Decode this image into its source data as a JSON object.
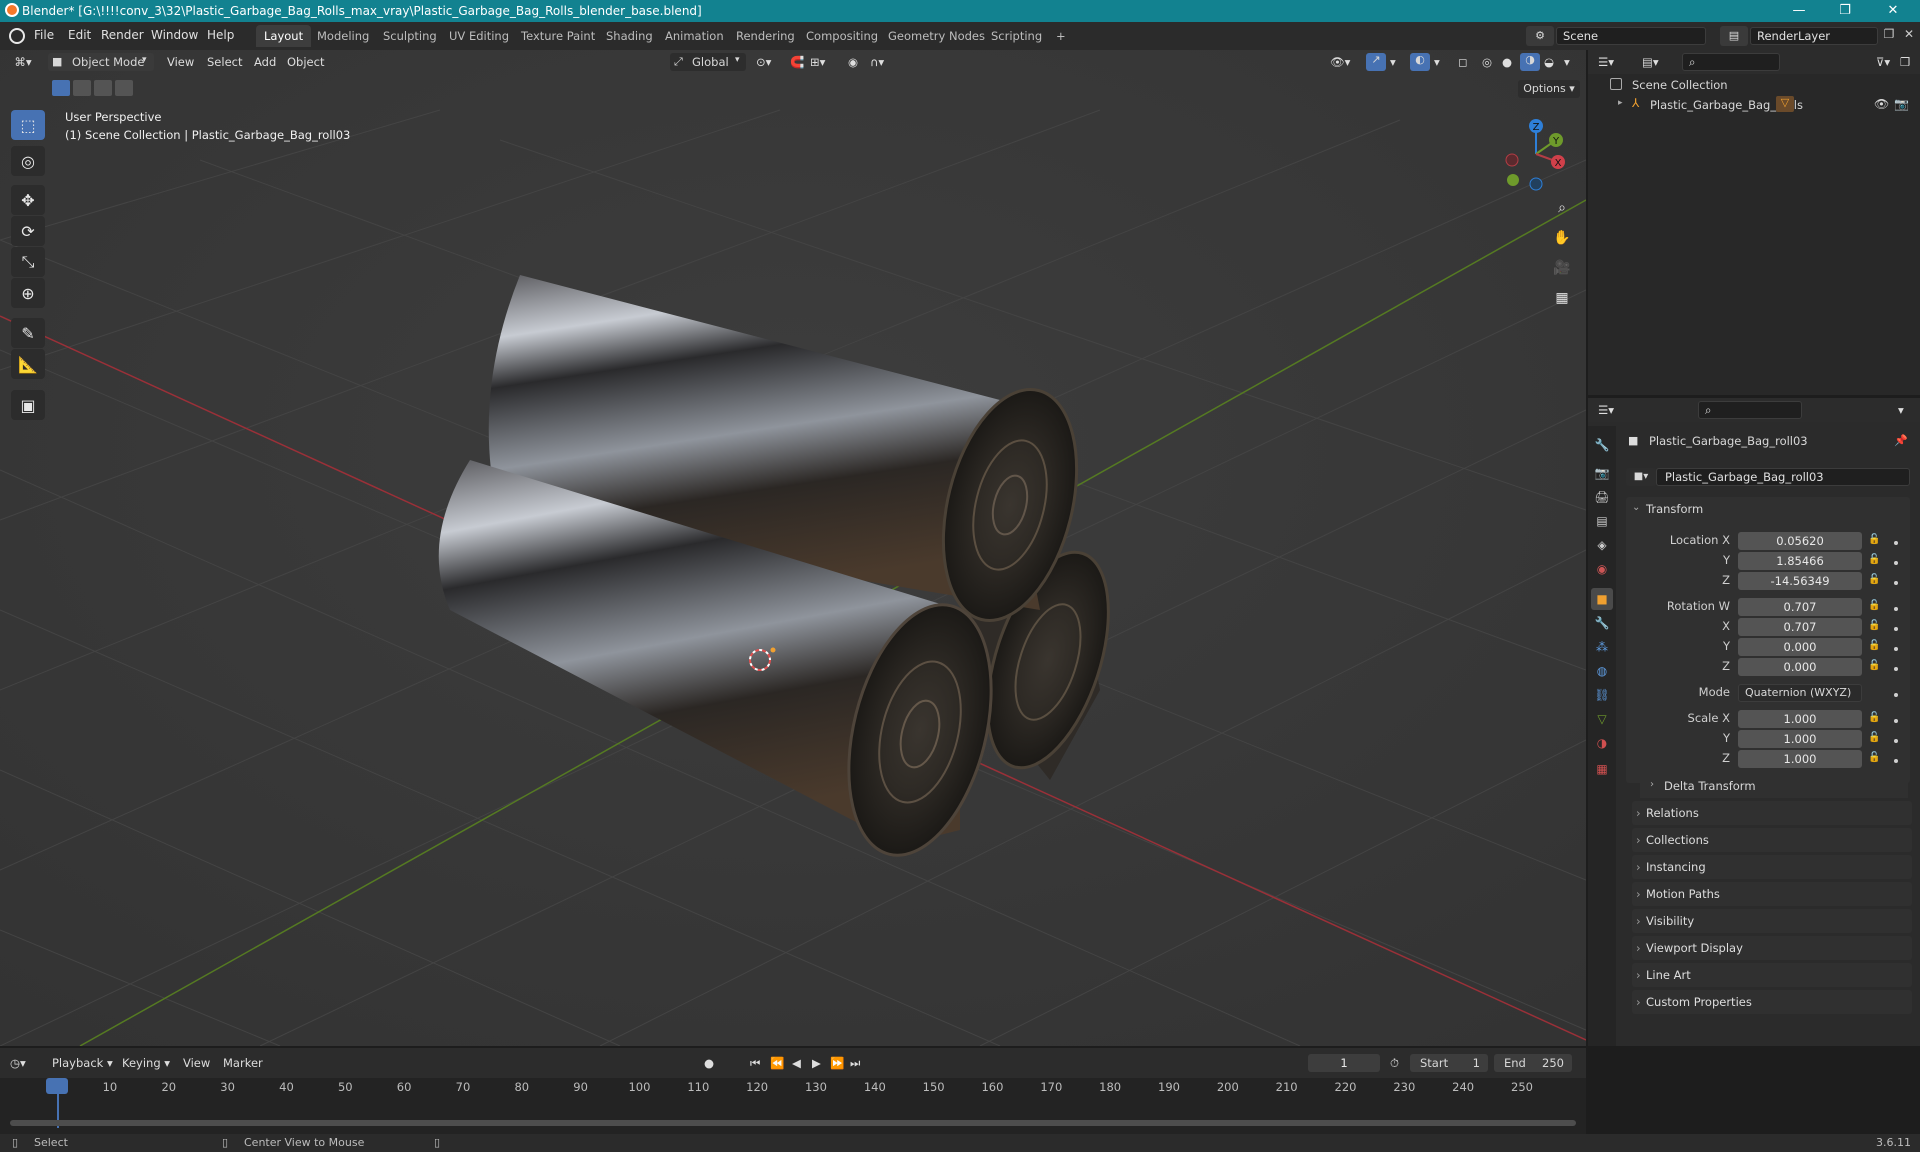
{
  "window": {
    "title": "Blender* [G:\\!!!!conv_3\\32\\Plastic_Garbage_Bag_Rolls_max_vray\\Plastic_Garbage_Bag_Rolls_blender_base.blend]",
    "minimize": "—",
    "maximize": "❐",
    "close": "✕"
  },
  "menu": [
    "File",
    "Edit",
    "Render",
    "Window",
    "Help"
  ],
  "workspaces": [
    "Layout",
    "Modeling",
    "Sculpting",
    "UV Editing",
    "Texture Paint",
    "Shading",
    "Animation",
    "Rendering",
    "Compositing",
    "Geometry Nodes",
    "Scripting",
    "+"
  ],
  "scene_name": "Scene",
  "render_layer": "RenderLayer",
  "viewport": {
    "mode": "Object Mode",
    "menus": [
      "View",
      "Select",
      "Add",
      "Object"
    ],
    "orientation": "Global",
    "options": "Options",
    "overlay_title": "User Perspective",
    "overlay_sub": "(1) Scene Collection | Plastic_Garbage_Bag_roll03",
    "gizmo": {
      "x": "X",
      "y": "Y",
      "z": "Z"
    }
  },
  "outliner": {
    "root": "Scene Collection",
    "item": "Plastic_Garbage_Bag_Rolls"
  },
  "properties": {
    "object_name": "Plastic_Garbage_Bag_roll03",
    "datablock": "Plastic_Garbage_Bag_roll03",
    "transform_title": "Transform",
    "location_label": "Location X",
    "loc_y_label": "Y",
    "loc_z_label": "Z",
    "location": [
      "0.05620",
      "1.85466",
      "-14.56349"
    ],
    "rotation_label": "Rotation W",
    "rot_x_label": "X",
    "rot_y_label": "Y",
    "rot_z_label": "Z",
    "rotation": [
      "0.707",
      "0.707",
      "0.000",
      "0.000"
    ],
    "mode_label": "Mode",
    "mode_value": "Quaternion (WXYZ)",
    "scale_label": "Scale X",
    "scale_y_label": "Y",
    "scale_z_label": "Z",
    "scale": [
      "1.000",
      "1.000",
      "1.000"
    ],
    "delta": "Delta Transform",
    "sections": [
      "Relations",
      "Collections",
      "Instancing",
      "Motion Paths",
      "Visibility",
      "Viewport Display",
      "Line Art",
      "Custom Properties"
    ]
  },
  "timeline": {
    "menus": [
      "Playback",
      "Keying",
      "View",
      "Marker"
    ],
    "current_frame": "1",
    "start_label": "Start",
    "start": "1",
    "end_label": "End",
    "end": "250",
    "frames": [
      "1",
      "10",
      "20",
      "30",
      "40",
      "50",
      "60",
      "70",
      "80",
      "90",
      "100",
      "110",
      "120",
      "130",
      "140",
      "150",
      "160",
      "170",
      "180",
      "190",
      "200",
      "210",
      "220",
      "230",
      "240",
      "250"
    ]
  },
  "status": {
    "left": "Select",
    "middle": "Center View to Mouse",
    "version": "3.6.11"
  },
  "colors": {
    "accent": "#4772b3",
    "title_bar": "#128290",
    "x_axis": "#b33d45",
    "y_axis": "#6e9a2b",
    "z_axis": "#2e7fd8"
  }
}
